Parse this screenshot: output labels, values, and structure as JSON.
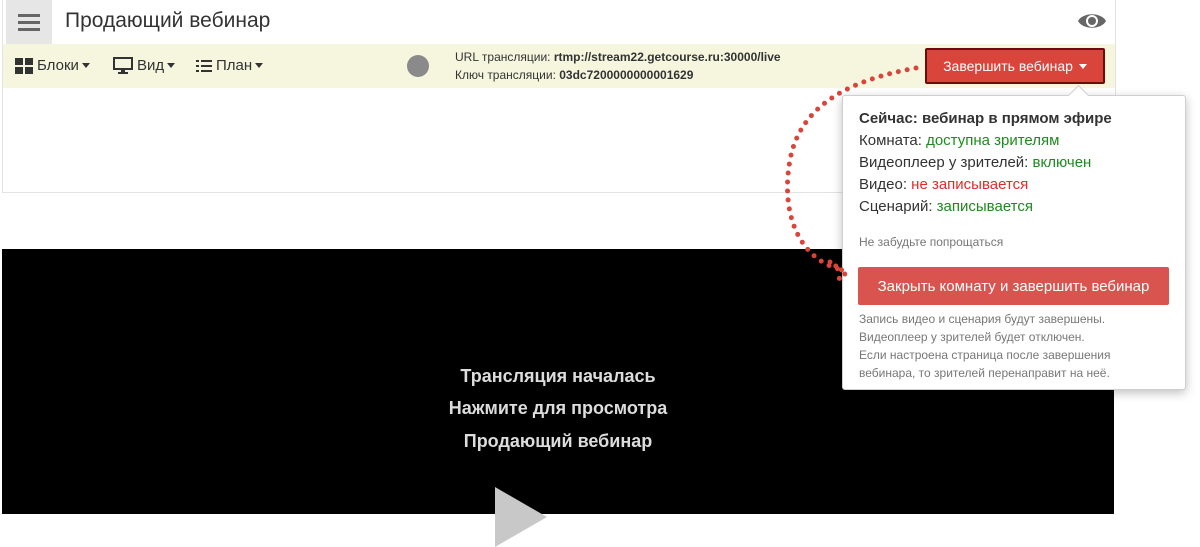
{
  "header": {
    "title": "Продающий вебинар",
    "menu_icon": "hamburger-menu-icon",
    "preview_icon": "eye-icon"
  },
  "toolbar": {
    "blocks_label": "Блоки",
    "view_label": "Вид",
    "plan_label": "План",
    "stream_url_label": "URL трансляции:",
    "stream_url_value": "rtmp://stream22.getcourse.ru:30000/live",
    "stream_key_label": "Ключ трансляции:",
    "stream_key_value": "03dc7200000000001629",
    "end_button_label": "Завершить вебинар"
  },
  "popup": {
    "now_label": "Сейчас: вебинар в прямом эфире",
    "room_label": "Комната:",
    "room_value": "доступна зрителям",
    "player_label": "Видеоплеер у зрителей:",
    "player_value": "включен",
    "video_label": "Видео:",
    "video_value": "не записывается",
    "script_label": "Сценарий:",
    "script_value": "записывается",
    "reminder": "Не забудьте попрощаться",
    "close_button_label": "Закрыть комнату и завершить вебинар",
    "note_lines": [
      "Запись видео и сценария будут завершены.",
      "Видеоплеер у зрителей будет отключен.",
      "Если настроена страница после завершения",
      "вебинара, то зрителей перенаправит на неё."
    ]
  },
  "video": {
    "line1": "Трансляция началась",
    "line2": "Нажмите для просмотра",
    "line3": "Продающий вебинар"
  },
  "colors": {
    "accent_red": "#d9443b",
    "status_green": "#1e8a1e",
    "status_red": "#e12b2b",
    "toolbar_bg": "#f6f6df"
  }
}
